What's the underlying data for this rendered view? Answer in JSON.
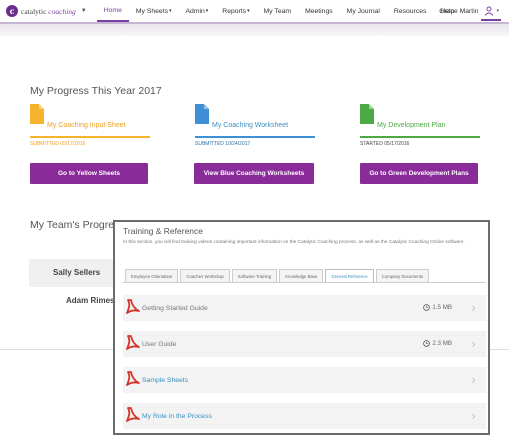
{
  "nav": {
    "logo_prefix": "catalytic",
    "logo_brand": "coaching",
    "items": [
      {
        "label": "Home",
        "caret": false,
        "active": true
      },
      {
        "label": "My Sheets",
        "caret": true
      },
      {
        "label": "Admin",
        "caret": true
      },
      {
        "label": "Reports",
        "caret": true
      },
      {
        "label": "My Team",
        "caret": false
      },
      {
        "label": "Meetings",
        "caret": false
      },
      {
        "label": "My Journal",
        "caret": false
      },
      {
        "label": "Resources",
        "caret": false
      },
      {
        "label": "Help",
        "caret": false
      }
    ],
    "user_name": "Grace Martin"
  },
  "progress": {
    "title": "My Progress This Year 2017",
    "cards": [
      {
        "name": "My Coaching Input Sheet",
        "status": "SUBMITTED 05/17/2016",
        "button": "Go to Yellow Sheets",
        "color": "#f5b32e",
        "text_color": "#f0a020",
        "line_color": "#f5b32e"
      },
      {
        "name": "My Coaching Worksheet",
        "status": "SUBMITTED 10/24/2017",
        "button": "View Blue Coaching Worksheets",
        "color": "#3f8fd6",
        "text_color": "#3a8fc1",
        "line_color": "#3f8fd6"
      },
      {
        "name": "My Development Plan",
        "status": "STARTED 05/17/2016",
        "button": "Go to Green Development Plans",
        "color": "#4caa44",
        "text_color": "#4caa44",
        "line_color": "#4caa44"
      }
    ]
  },
  "team": {
    "title": "My Team's Progress",
    "members": [
      "Sally Sellers",
      "Adam Rimes"
    ]
  },
  "panel": {
    "title": "Training & Reference",
    "description": "In this section, you will find training videos containing important information on the Catalytic Coaching process, as well as the Catalytic Coaching Online software.",
    "tabs": [
      {
        "label": "Employee Orientation",
        "active": false
      },
      {
        "label": "Coaches Workshop",
        "active": false
      },
      {
        "label": "Software Training",
        "active": false
      },
      {
        "label": "Knowledge Base",
        "active": false
      },
      {
        "label": "General Reference",
        "active": true
      },
      {
        "label": "Company Documents",
        "active": false
      }
    ],
    "documents": [
      {
        "name": "Getting Started Guide",
        "size": "1.5 MB",
        "link": false
      },
      {
        "name": "User Guide",
        "size": "2.3 MB",
        "link": false
      },
      {
        "name": "Sample Sheets",
        "size": "",
        "link": true
      },
      {
        "name": "My Role in the Process",
        "size": "",
        "link": true
      }
    ]
  },
  "colors": {
    "accent": "#7a3fa0",
    "button": "#8a2b9a",
    "pdf_red": "#d3352b",
    "link": "#3a8fc1"
  }
}
